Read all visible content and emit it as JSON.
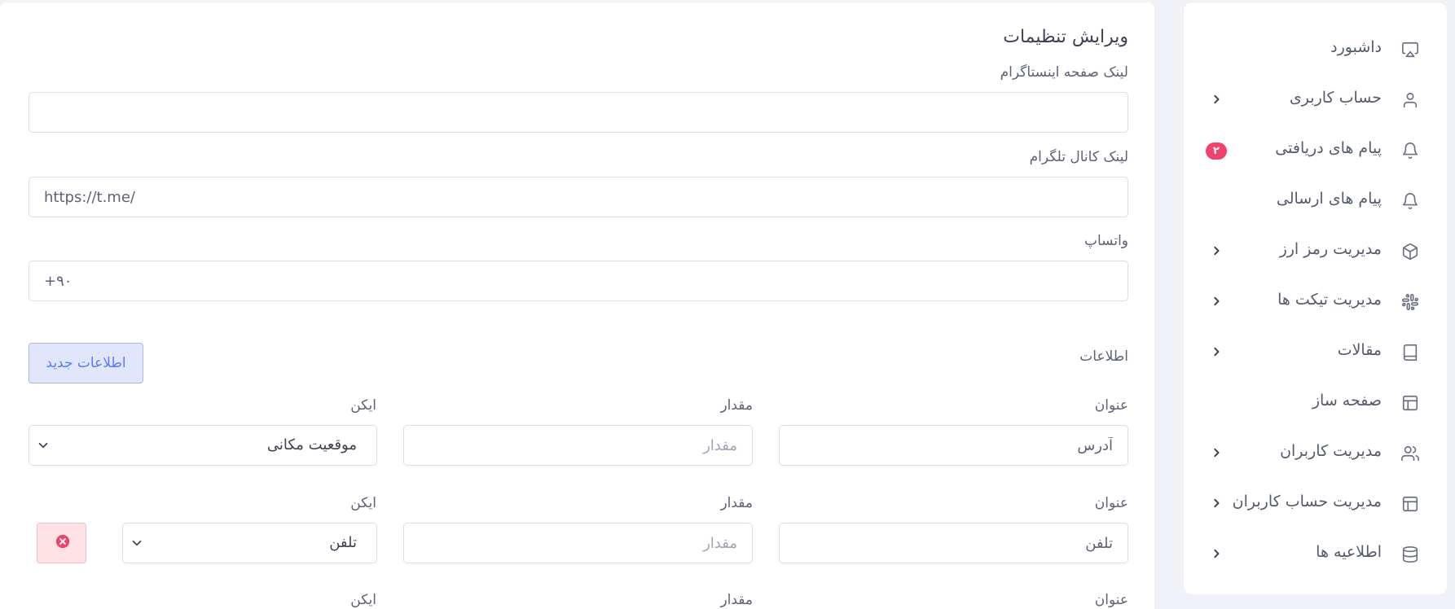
{
  "sidebar": {
    "items": [
      {
        "label": "داشبورد",
        "icon": "monitor-icon"
      },
      {
        "label": "حساب کاربری",
        "icon": "user-icon"
      },
      {
        "label": "پیام های دریافتی",
        "icon": "bell-icon",
        "badge": "۲"
      },
      {
        "label": "پیام های ارسالی",
        "icon": "bell-icon"
      },
      {
        "label": "مدیریت رمز ارز",
        "icon": "box-icon"
      },
      {
        "label": "مدیریت تیکت ها",
        "icon": "slack-icon"
      },
      {
        "label": "مقالات",
        "icon": "book-icon"
      },
      {
        "label": "صفحه ساز",
        "icon": "layout-icon"
      },
      {
        "label": "مدیریت کاربران",
        "icon": "users-icon"
      },
      {
        "label": "مدیریت حساب کاربران",
        "icon": "layout-icon"
      },
      {
        "label": "اطلاعیه ها",
        "icon": "database-icon"
      }
    ],
    "badge_color": "#f1416c"
  },
  "form": {
    "title": "ویرایش تنظیمات",
    "instagram": {
      "label": "لینک صفحه اینستاگرام",
      "value": ""
    },
    "telegram": {
      "label": "لینک کانال تلگرام",
      "value": "https://t.me/"
    },
    "whatsapp": {
      "label": "واتساپ",
      "value": "+۹۰"
    },
    "info_section_label": "اطلاعات",
    "new_info_button": "اطلاعات جدید",
    "columns": {
      "title": "عنوان",
      "value": "مقدار",
      "icon": "ایکن"
    },
    "rows": [
      {
        "title": "آدرس",
        "value": "",
        "value_placeholder": "مقدار",
        "icon": "موقعیت مکانی"
      },
      {
        "title": "تلفن",
        "value": "",
        "value_placeholder": "مقدار",
        "icon": "تلفن"
      }
    ]
  },
  "colors": {
    "accent": "#5d78ff",
    "danger": "#f1416c",
    "background": "#f1f2f8"
  }
}
